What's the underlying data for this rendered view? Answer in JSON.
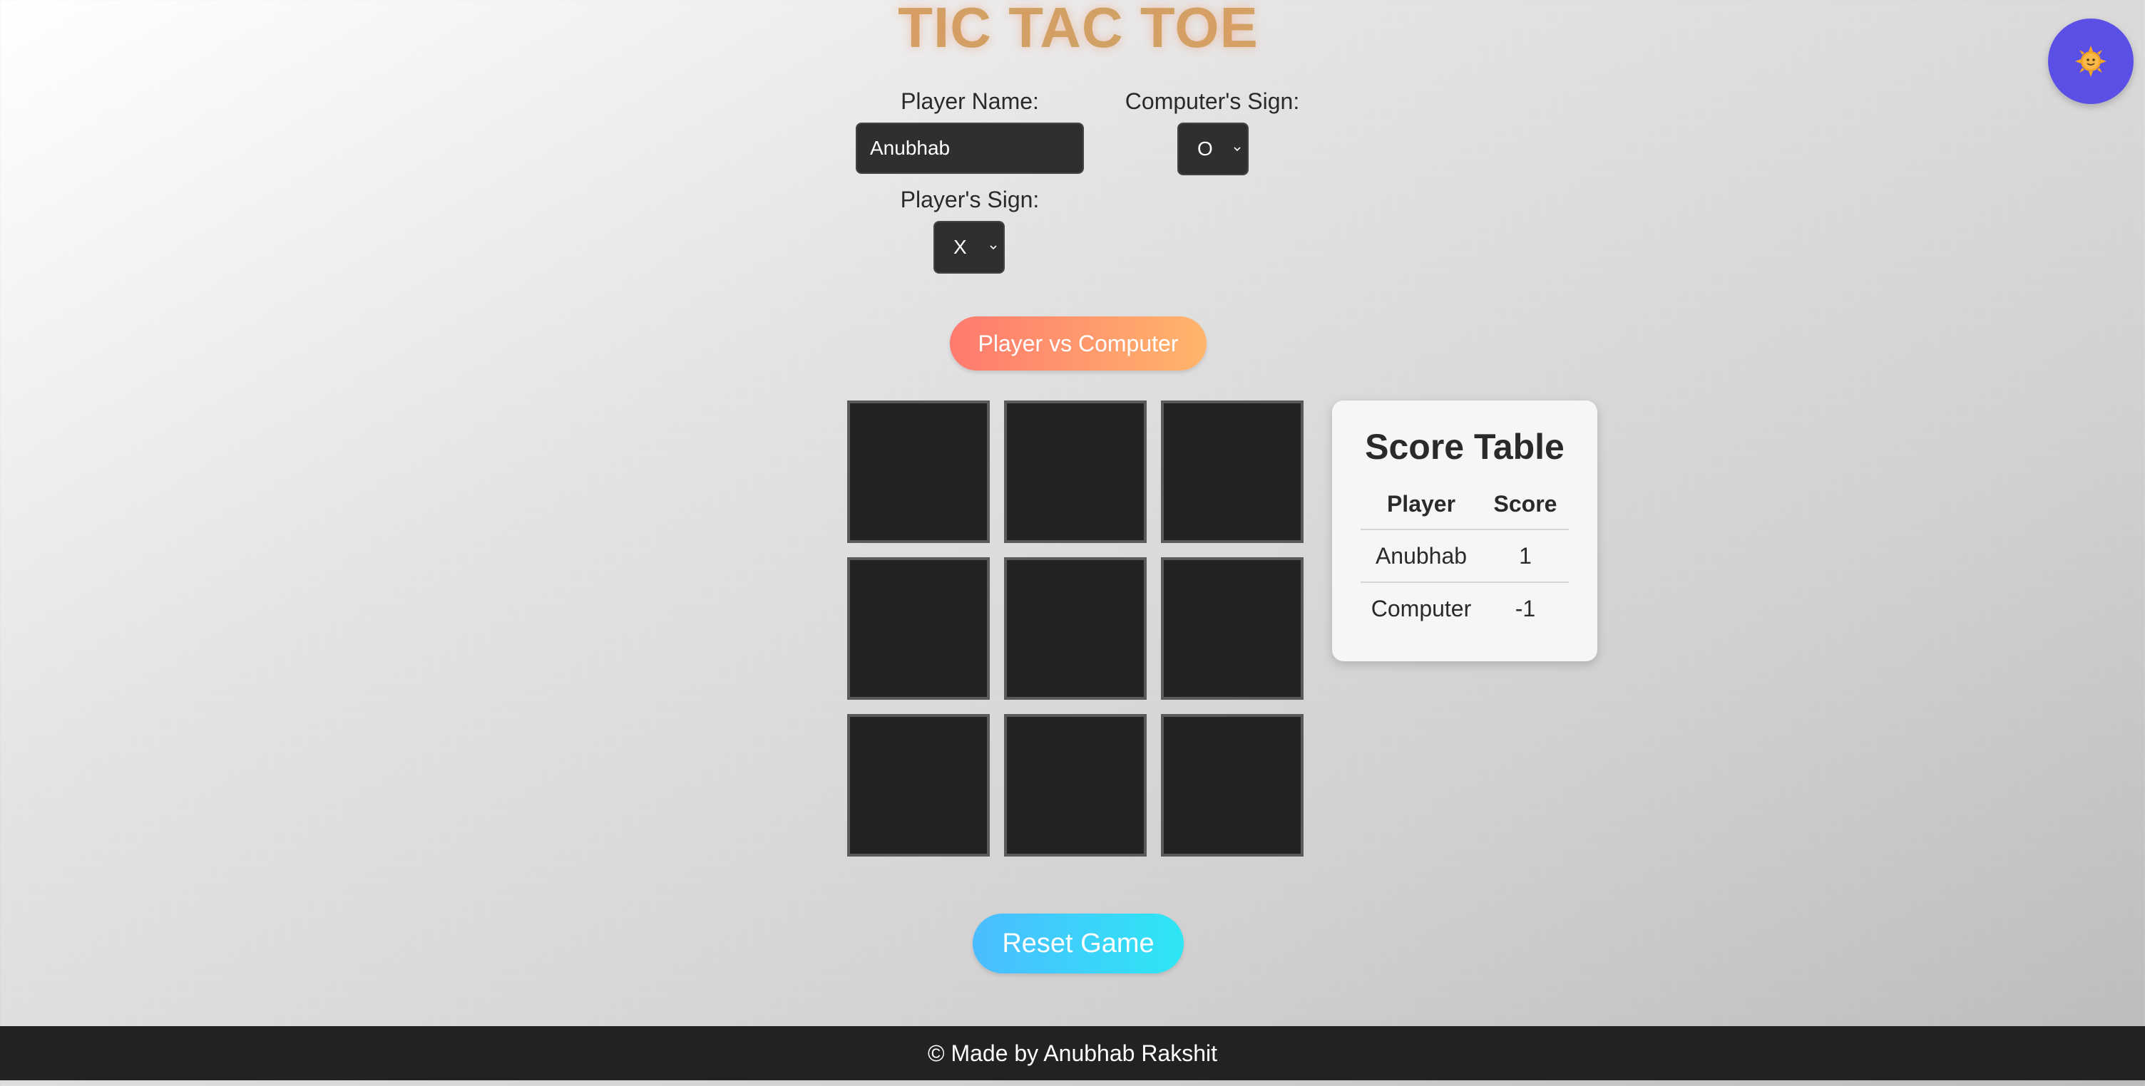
{
  "header": {
    "title": "TIC TAC TOE"
  },
  "theme_toggle": {
    "icon": "sun-icon",
    "background": "#5b50e6"
  },
  "settings": {
    "player_name_label": "Player Name:",
    "player_name_value": "Anubhab",
    "computer_sign_label": "Computer's Sign:",
    "computer_sign_value": "O",
    "player_sign_label": "Player's Sign:",
    "player_sign_value": "X"
  },
  "mode_button": {
    "label": "Player vs Computer"
  },
  "board": {
    "cells": [
      "",
      "",
      "",
      "",
      "",
      "",
      "",
      "",
      ""
    ]
  },
  "score_table": {
    "title": "Score Table",
    "headers": [
      "Player",
      "Score"
    ],
    "rows": [
      {
        "player": "Anubhab",
        "score": "1"
      },
      {
        "player": "Computer",
        "score": "-1"
      }
    ]
  },
  "reset_button": {
    "label": "Reset Game"
  },
  "footer": {
    "text": "© Made by Anubhab Rakshit"
  },
  "colors": {
    "cell_bg": "#232323",
    "mode_button_gradient": [
      "#ff7a6e",
      "#ffb56b"
    ],
    "reset_button_gradient": [
      "#4bbcff",
      "#2ee6f4"
    ],
    "footer_bg": "#222222"
  }
}
